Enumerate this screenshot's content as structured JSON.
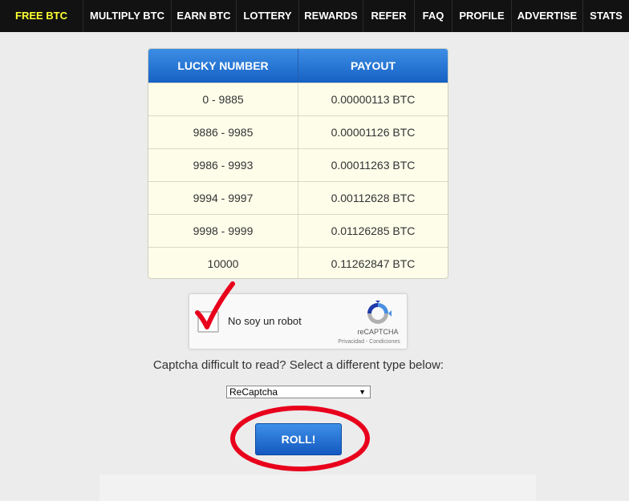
{
  "nav": {
    "items": [
      {
        "label": "FREE BTC",
        "active": true
      },
      {
        "label": "MULTIPLY BTC"
      },
      {
        "label": "EARN BTC"
      },
      {
        "label": "LOTTERY"
      },
      {
        "label": "REWARDS"
      },
      {
        "label": "REFER"
      },
      {
        "label": "FAQ"
      },
      {
        "label": "PROFILE"
      },
      {
        "label": "ADVERTISE"
      },
      {
        "label": "STATS"
      }
    ]
  },
  "payout_table": {
    "headers": [
      "LUCKY NUMBER",
      "PAYOUT"
    ],
    "rows": [
      {
        "range": "0 - 9885",
        "payout": "0.00000113 BTC"
      },
      {
        "range": "9886 - 9985",
        "payout": "0.00001126 BTC"
      },
      {
        "range": "9986 - 9993",
        "payout": "0.00011263 BTC"
      },
      {
        "range": "9994 - 9997",
        "payout": "0.00112628 BTC"
      },
      {
        "range": "9998 - 9999",
        "payout": "0.01126285 BTC"
      },
      {
        "range": "10000",
        "payout": "0.11262847 BTC"
      }
    ]
  },
  "recaptcha": {
    "label": "No soy un robot",
    "brand": "reCAPTCHA",
    "links": "Privacidad - Condiciones"
  },
  "captcha_note": "Captcha difficult to read? Select a different type below:",
  "captcha_select": {
    "value": "ReCaptcha"
  },
  "roll_button": {
    "label": "ROLL!"
  },
  "colors": {
    "nav_bg": "#121212",
    "nav_active": "#ffff33",
    "table_header": "#2a78d8",
    "table_body": "#fdfdea",
    "annotation_red": "#e8001c"
  },
  "icons": {
    "recaptcha": "recaptcha-logo-icon",
    "check": "red-checkmark-icon",
    "select_arrow": "triangle-down-icon"
  }
}
